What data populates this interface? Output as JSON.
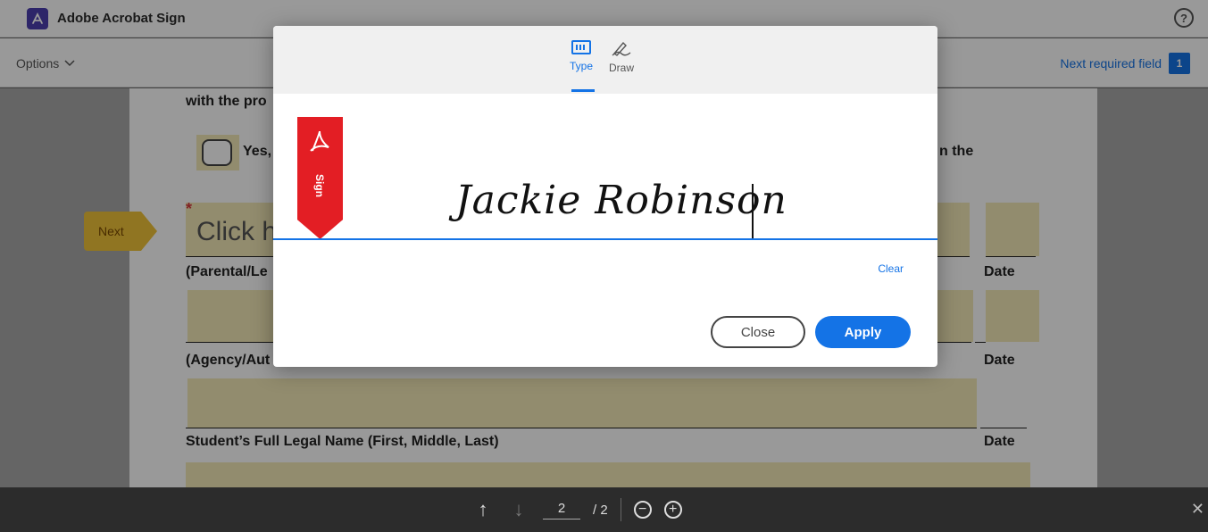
{
  "app": {
    "title": "Adobe Acrobat Sign",
    "help_glyph": "?"
  },
  "options_bar": {
    "options_label": "Options",
    "next_required_label": "Next required field",
    "next_required_count": "1"
  },
  "document": {
    "line1": "with the pro",
    "checkbox_label": "Yes,",
    "line2_right": "n the",
    "required_star": "*",
    "click_here": "Click h",
    "next_tag": "Next",
    "label_parental": "(Parental/Le",
    "label_agency": "(Agency/Aut",
    "label_student": "Student’s Full Legal Name (First, Middle, Last)",
    "label_date": "Date"
  },
  "modal": {
    "tabs": [
      {
        "label": "Type",
        "icon": "keyboard-icon"
      },
      {
        "label": "Draw",
        "icon": "pen-draw-icon"
      }
    ],
    "ribbon_text": "Sign",
    "signature_text": "Jackie Robinson",
    "clear_label": "Clear",
    "close_label": "Close",
    "apply_label": "Apply"
  },
  "bottom_bar": {
    "current_page": "2",
    "total_pages": "/ 2",
    "close_glyph": "✕"
  },
  "colors": {
    "accent": "#1473e6",
    "ribbon": "#e31e24",
    "field": "#f4e9b8",
    "next_tag": "#f0c33a"
  }
}
